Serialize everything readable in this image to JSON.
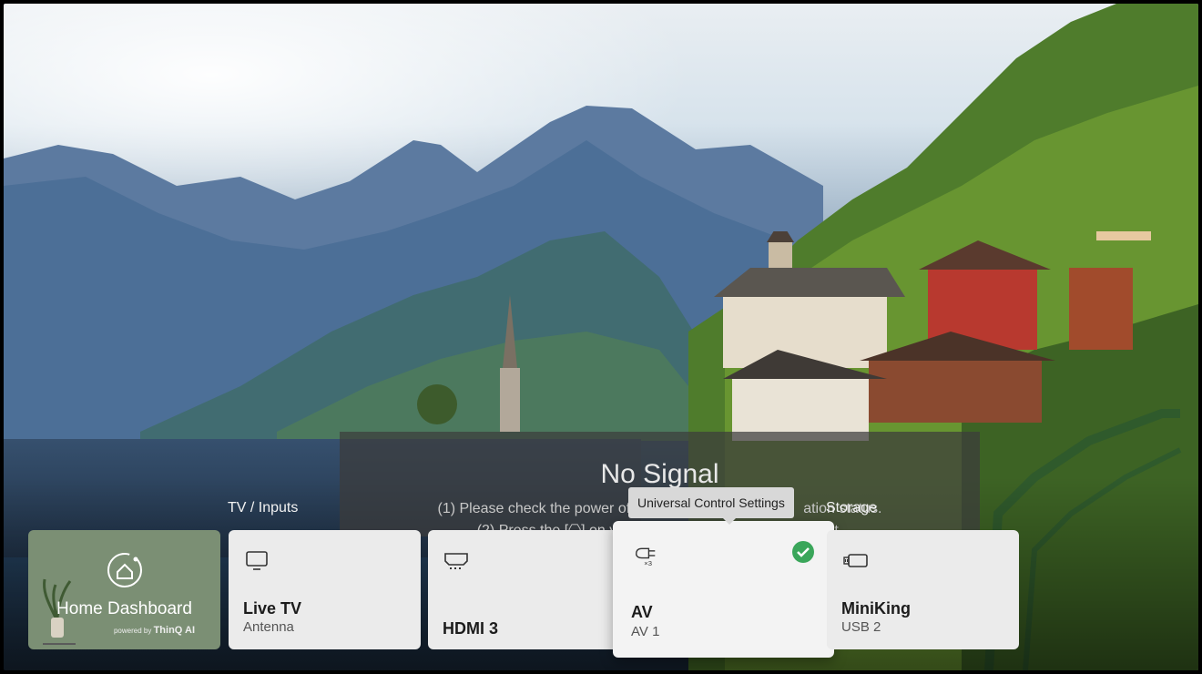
{
  "no_signal": {
    "title": "No Signal",
    "line1": "(1) Please check the power of the e",
    "line1_tail": "ation status.",
    "line2": "(2) Press the [",
    "line2_mid": "] on yo",
    "line2_tail": "input."
  },
  "sections": {
    "tv_inputs": "TV / Inputs",
    "storage": "Storage"
  },
  "tooltip": "Universal Control Settings",
  "cards": {
    "home": {
      "name": "Home Dashboard",
      "powered_prefix": "powered by",
      "powered_brand": "ThinQ AI",
      "icon": "home-dashboard-icon"
    },
    "livetv": {
      "name": "Live TV",
      "sub": "Antenna",
      "icon": "tv-icon"
    },
    "hdmi": {
      "name": "HDMI 3",
      "icon": "hdmi-icon"
    },
    "av": {
      "name": "AV",
      "sub": "AV 1",
      "icon": "av-icon",
      "selected": true
    },
    "usb": {
      "name": "MiniKing",
      "sub": "USB 2",
      "icon": "usb-storage-icon"
    }
  },
  "colors": {
    "home_card": "#7b8f74",
    "card": "#ebebeb",
    "check": "#3aa65a"
  }
}
